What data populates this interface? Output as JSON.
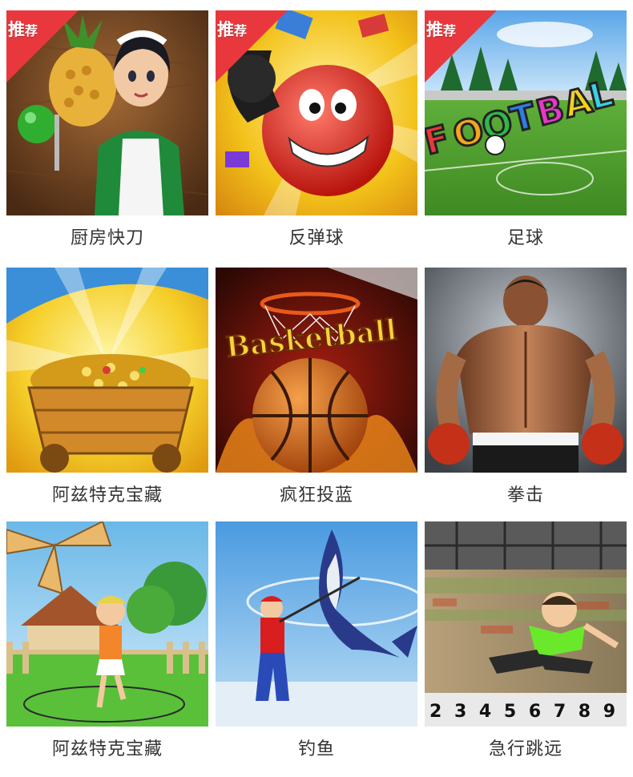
{
  "badge": {
    "char1": "推",
    "char2": "荐"
  },
  "colors": {
    "badge": "#e8383d",
    "label": "#333333",
    "background": "#ffffff"
  },
  "games": [
    {
      "title": "厨房快刀",
      "badge": true,
      "art": "kitchen-knife-maid-pineapple"
    },
    {
      "title": "反弹球",
      "badge": true,
      "art": "red-ball-with-boxing-glove"
    },
    {
      "title": "足球",
      "badge": true,
      "art": "football-logo-field",
      "logo_text": "FOOTBALL"
    },
    {
      "title": "阿兹特克宝藏",
      "badge": false,
      "art": "gold-coin-mine-cart"
    },
    {
      "title": "疯狂投蓝",
      "badge": false,
      "art": "basketball-fire-hoop",
      "logo_text": "Basketball"
    },
    {
      "title": "拳击",
      "badge": false,
      "art": "boxer-back-view"
    },
    {
      "title": "阿兹特克宝藏",
      "badge": false,
      "art": "girl-jump-rope-windmill"
    },
    {
      "title": "钓鱼",
      "badge": false,
      "art": "fisherman-marlin"
    },
    {
      "title": "急行跳远",
      "badge": false,
      "art": "long-jump-athlete",
      "track_numbers": "2 3 4 5 6 7 8 9"
    }
  ]
}
